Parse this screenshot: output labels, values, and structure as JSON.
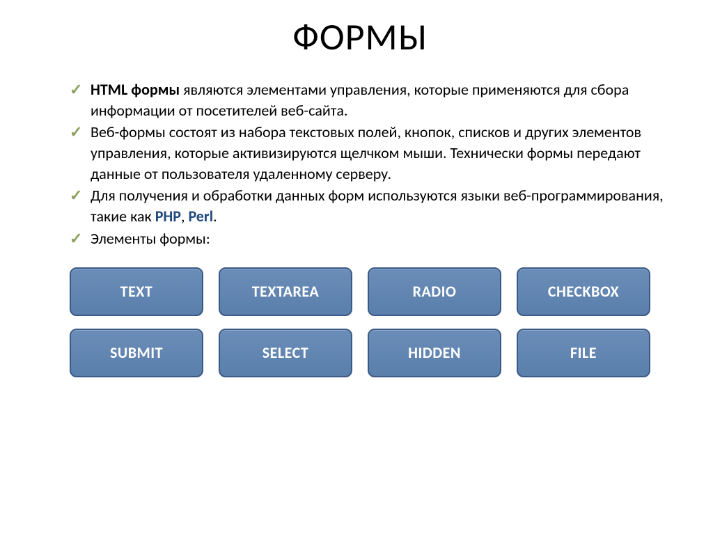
{
  "title": "ФОРМЫ",
  "bullets": [
    {
      "prefix_bold": "HTML формы",
      "text_after_prefix": " являются элементами управления, которые применяются для сбора информации от посетителей веб-сайта."
    },
    {
      "text": "Веб-формы состоят из набора текстовых полей, кнопок, списков и других элементов управления, которые активизируются щелчком мыши. Технически формы передают данные от пользователя удаленному серверу."
    },
    {
      "text_before_php": "Для получения и обработки данных форм используются языки веб-программирования, такие как ",
      "php": "PHP",
      "sep": ", ",
      "perl": "Perl",
      "end": "."
    },
    {
      "text": "Элементы формы:"
    }
  ],
  "buttons": {
    "row1": [
      "TEXT",
      "TEXTAREA",
      "RADIO",
      "CHECKBOX"
    ],
    "row2": [
      "SUBMIT",
      "SELECT",
      "HIDDEN",
      "FILE"
    ]
  }
}
